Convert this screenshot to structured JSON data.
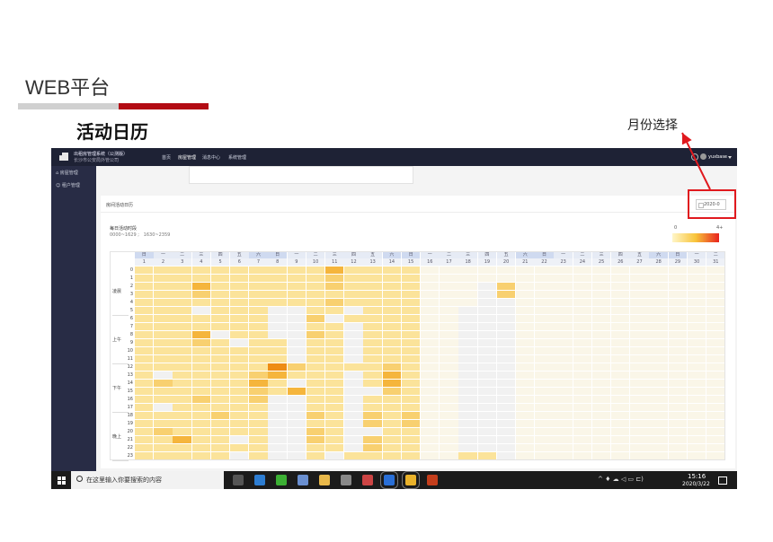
{
  "slide": {
    "title": "WEB平台",
    "section_title": "活动日历",
    "annotation": "月份选择"
  },
  "app": {
    "name": "出租房管理系统（公测版）",
    "org": "长沙市公安局外管公司",
    "nav": [
      {
        "label": "首页"
      },
      {
        "label": "房屋管理"
      },
      {
        "label": "消息中心"
      },
      {
        "label": "系统管理"
      }
    ],
    "user": "yuxbase",
    "sidebar": [
      {
        "label": "房屋管理",
        "icon": "home-icon"
      },
      {
        "label": "租户管理",
        "icon": "person-icon"
      }
    ]
  },
  "calendar": {
    "card_title": "房间活动日历",
    "month_value": "2020-0",
    "legend": {
      "min": "0",
      "max": "4+",
      "color_low": "#fff6c8",
      "color_high": "#e8231e"
    },
    "time_label": "每日活动时段",
    "time_ranges": "0000~1629 ;   1630~2359",
    "weekdays": [
      "日",
      "一",
      "二",
      "三",
      "四",
      "五",
      "六",
      "日",
      "一",
      "二",
      "三",
      "四",
      "五",
      "六",
      "日",
      "一",
      "二",
      "三",
      "四",
      "五",
      "六",
      "日",
      "一",
      "二",
      "三",
      "四",
      "五",
      "六",
      "日",
      "一",
      "二"
    ],
    "days": [
      "1",
      "2",
      "3",
      "4",
      "5",
      "6",
      "7",
      "8",
      "9",
      "10",
      "11",
      "12",
      "13",
      "14",
      "15",
      "16",
      "17",
      "18",
      "19",
      "20",
      "21",
      "22",
      "23",
      "24",
      "25",
      "26",
      "27",
      "28",
      "29",
      "30",
      "31"
    ],
    "hours": [
      "0",
      "1",
      "2",
      "3",
      "4",
      "5",
      "6",
      "7",
      "8",
      "9",
      "10",
      "11",
      "12",
      "13",
      "14",
      "15",
      "16",
      "17",
      "18",
      "19",
      "20",
      "21",
      "22",
      "23"
    ],
    "periods": [
      {
        "label": "凌晨",
        "start": 0,
        "end": 5
      },
      {
        "label": "上午",
        "start": 6,
        "end": 11
      },
      {
        "label": "下午",
        "start": 12,
        "end": 17
      },
      {
        "label": "晚上",
        "start": 18,
        "end": 23
      }
    ],
    "palette": [
      "#f1f1f1",
      "#fbe39a",
      "#f8d070",
      "#f5b53c",
      "#ee8c14",
      "#faf6e8"
    ],
    "levels": [
      "1111111111311115555555555",
      "1111111111211115555555555",
      "1113111111211115550255555",
      "1112111111111115550255555",
      "1111111111211115550055555",
      "1110111001101115500055555",
      "1111111002011115500055555",
      "1111111001101115500055555",
      "1113011002101115500055555",
      "1112101101101115500055555",
      "1111111101101115500055555",
      "1111111101101115500055555",
      "1111111421111215500055555",
      "1011112311101315500055555",
      "1211113101101315500055555",
      "1111112131100215500055555",
      "1112112001101115500055555",
      "1011111001101115500055555",
      "1111211002102125500055555",
      "1111111001102125500055555",
      "1211111002100115500055555",
      "1131101002102115500055555",
      "1111111001102115500055555",
      "1111101001011115511055555"
    ]
  },
  "taskbar": {
    "search_placeholder": "在这里输入你要搜索的内容",
    "time": "15:16",
    "date": "2020/3/22",
    "apps": [
      {
        "icon": "task-view-icon"
      },
      {
        "icon": "edge-icon"
      },
      {
        "icon": "wechat-icon"
      },
      {
        "icon": "notes-icon"
      },
      {
        "icon": "explorer-icon"
      },
      {
        "icon": "calculator-icon"
      },
      {
        "icon": "app-grid-icon"
      },
      {
        "icon": "search-app-icon"
      },
      {
        "icon": "chrome-icon"
      },
      {
        "icon": "powerpoint-icon"
      }
    ]
  }
}
